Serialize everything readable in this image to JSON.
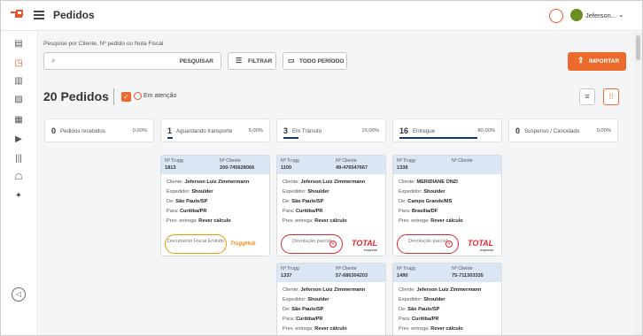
{
  "header": {
    "title": "Pedidos",
    "user_name": "Jeferson..."
  },
  "search": {
    "label": "Pesquise por Cliente, Nº pedido ou Nota Fiscal",
    "placeholder": "",
    "button": "PESQUISAR"
  },
  "toolbar": {
    "filter": "FILTRAR",
    "period": "TODO PERÍODO",
    "import": "IMPORTAR"
  },
  "summary": {
    "count": "20 Pedidos",
    "attention": "Em atenção"
  },
  "columns": [
    {
      "num": "0",
      "label": "Pedidos recebidos",
      "pct": "0,00%",
      "fill": 0
    },
    {
      "num": "1",
      "label": "Aguardando transporte",
      "pct": "5,00%",
      "fill": 0.05
    },
    {
      "num": "3",
      "label": "Em Trânsito",
      "pct": "15,00%",
      "fill": 0.15
    },
    {
      "num": "16",
      "label": "Entregue",
      "pct": "80,00%",
      "fill": 0.8
    },
    {
      "num": "0",
      "label": "Suspenso / Cancelado",
      "pct": "0,00%",
      "fill": 0
    }
  ],
  "labels": {
    "n_trugg": "Nº Trugg",
    "n_cliente": "Nº Cliente",
    "cliente": "Cliente:",
    "expedidor": "Expedidor:",
    "de": "De:",
    "para": "Para:",
    "prev": "Prev. entrega:"
  },
  "cards": [
    {
      "trugg": "1813",
      "cliente_n": "200-745628066",
      "cliente": "Jeferson Luiz Zimmermann",
      "expedidor": "Shoulder",
      "de": "São Paulo/SP",
      "para": "Curitiba/PR",
      "prev": "Rever cálculo",
      "action": "Documento Fiscal Emitido",
      "brand": "TruggHub"
    },
    {
      "trugg": "1100",
      "cliente_n": "49-476547667",
      "cliente": "Jeferson Luiz Zimmermann",
      "expedidor": "Shoulder",
      "de": "São Paulo/SP",
      "para": "Curitiba/PR",
      "prev": "Rever cálculo",
      "action": "Devolução parcial",
      "brand": "TOTAL",
      "brand_sub": "express"
    },
    {
      "trugg": "1338",
      "cliente_n": "",
      "cliente": "MERIDIANE ONZI",
      "expedidor": "Shoulder",
      "de": "Campo Grande/MS",
      "para": "Brasília/DF",
      "prev": "Rever cálculo",
      "action": "Devolução parcial",
      "brand": "TOTAL",
      "brand_sub": "express"
    },
    {
      "trugg": "1337",
      "cliente_n": "57-686304203",
      "cliente": "Jeferson Luiz Zimmermann",
      "expedidor": "Shoulder",
      "de": "São Paulo/SP",
      "para": "Curitiba/PR",
      "prev": "Rever cálculo"
    },
    {
      "trugg": "1490",
      "cliente_n": "75-711303335",
      "cliente": "Jeferson Luiz Zimmermann",
      "expedidor": "Shoulder",
      "de": "São Paulo/SP",
      "para": "Curitiba/PR",
      "prev": "Rever cálculo"
    }
  ],
  "colors": {
    "accent": "#ec6a2b",
    "header_blue": "#dbe6f5",
    "progress": "#0d3b6e"
  }
}
